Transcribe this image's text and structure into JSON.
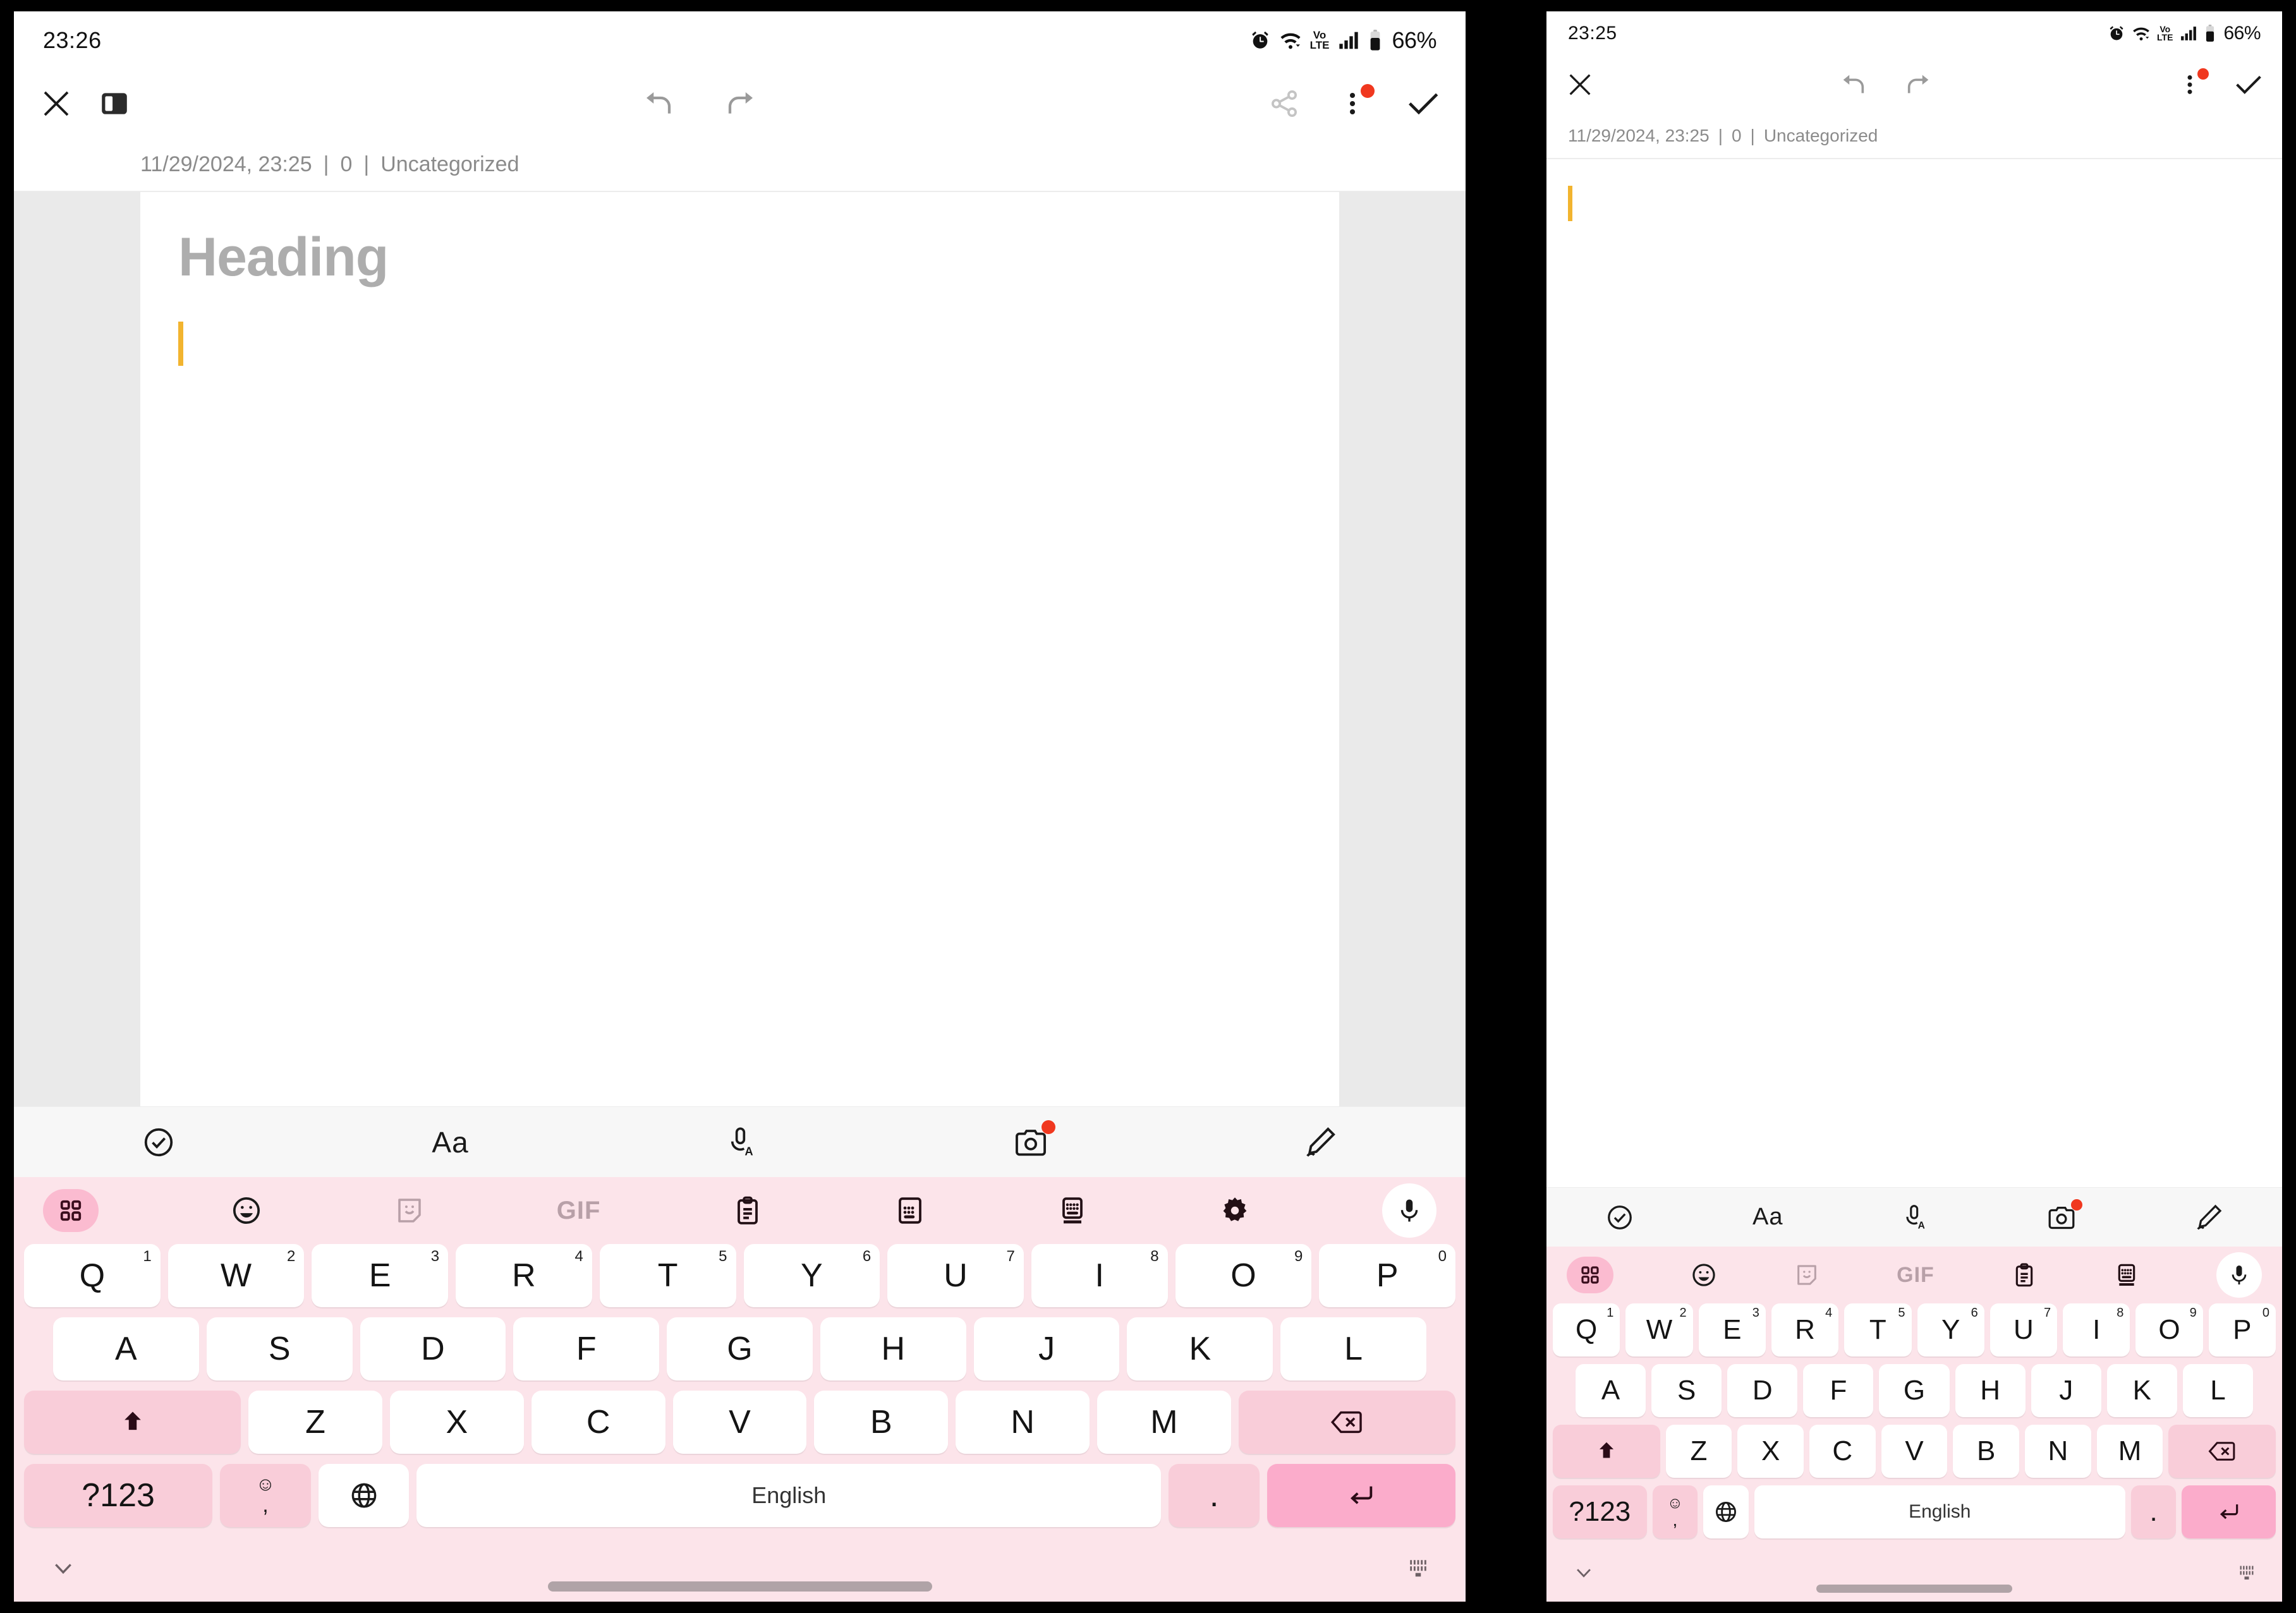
{
  "panels": {
    "left": {
      "status": {
        "time": "23:26",
        "battery": "66%",
        "volte_top": "Vo",
        "volte_bottom": "LTE"
      },
      "toolbar": {
        "close_label": "close-icon",
        "sidebar_label": "sidebar-toggle-icon",
        "undo_label": "undo-icon",
        "redo_label": "redo-icon",
        "share_label": "share-icon",
        "more_label": "more-vertical-icon",
        "done_label": "check-icon",
        "has_badge": true
      },
      "meta": {
        "date": "11/29/2024, 23:25",
        "count": "0",
        "category": "Uncategorized",
        "separator": "|"
      },
      "editor": {
        "heading_placeholder": "Heading",
        "body_text": ""
      },
      "format_bar": [
        "checkbox-circle-icon",
        "text-format-icon",
        "voice-typing-icon",
        "camera-icon",
        "draw-icon"
      ],
      "format_aa_label": "Aa",
      "keyboard": {
        "toolbar_icons": [
          "grid-menu-icon",
          "emoji-icon",
          "sticker-icon",
          "gif-icon",
          "clipboard-icon",
          "split-keyboard-icon",
          "floating-keyboard-icon",
          "settings-gear-icon",
          "mic-icon"
        ],
        "gif_label": "GIF",
        "row1": [
          {
            "k": "Q",
            "n": "1"
          },
          {
            "k": "W",
            "n": "2"
          },
          {
            "k": "E",
            "n": "3"
          },
          {
            "k": "R",
            "n": "4"
          },
          {
            "k": "T",
            "n": "5"
          },
          {
            "k": "Y",
            "n": "6"
          },
          {
            "k": "U",
            "n": "7"
          },
          {
            "k": "I",
            "n": "8"
          },
          {
            "k": "O",
            "n": "9"
          },
          {
            "k": "P",
            "n": "0"
          }
        ],
        "row2": [
          "A",
          "S",
          "D",
          "F",
          "G",
          "H",
          "J",
          "K",
          "L"
        ],
        "row3": [
          "Z",
          "X",
          "C",
          "V",
          "B",
          "N",
          "M"
        ],
        "shift_label": "shift-icon",
        "backspace_label": "backspace-icon",
        "numeric_label": "?123",
        "emoji_comma_top": "☺",
        "emoji_comma_bottom": ",",
        "globe_label": "globe-icon",
        "space_label": "English",
        "period_label": ".",
        "enter_label": "enter-icon",
        "hide_label": "chevron-down-icon",
        "resize_label": "keyboard-resize-icon"
      }
    },
    "right": {
      "status": {
        "time": "23:25",
        "battery": "66%",
        "volte_top": "Vo",
        "volte_bottom": "LTE"
      },
      "toolbar": {
        "close_label": "close-icon",
        "undo_label": "undo-icon",
        "redo_label": "redo-icon",
        "more_label": "more-vertical-icon",
        "done_label": "check-icon",
        "has_badge": true
      },
      "meta": {
        "date": "11/29/2024, 23:25",
        "count": "0",
        "category": "Uncategorized",
        "separator": "|"
      },
      "editor": {
        "heading_placeholder": "",
        "body_text": ""
      },
      "format_bar": [
        "checkbox-circle-icon",
        "text-format-icon",
        "voice-typing-icon",
        "camera-icon",
        "draw-icon"
      ],
      "format_aa_label": "Aa",
      "keyboard": {
        "toolbar_icons": [
          "grid-menu-icon",
          "emoji-icon",
          "sticker-icon",
          "gif-icon",
          "clipboard-icon",
          "floating-keyboard-icon",
          "mic-icon"
        ],
        "gif_label": "GIF",
        "row1": [
          {
            "k": "Q",
            "n": "1"
          },
          {
            "k": "W",
            "n": "2"
          },
          {
            "k": "E",
            "n": "3"
          },
          {
            "k": "R",
            "n": "4"
          },
          {
            "k": "T",
            "n": "5"
          },
          {
            "k": "Y",
            "n": "6"
          },
          {
            "k": "U",
            "n": "7"
          },
          {
            "k": "I",
            "n": "8"
          },
          {
            "k": "O",
            "n": "9"
          },
          {
            "k": "P",
            "n": "0"
          }
        ],
        "row2": [
          "A",
          "S",
          "D",
          "F",
          "G",
          "H",
          "J",
          "K",
          "L"
        ],
        "row3": [
          "Z",
          "X",
          "C",
          "V",
          "B",
          "N",
          "M"
        ],
        "shift_label": "shift-icon",
        "backspace_label": "backspace-icon",
        "numeric_label": "?123",
        "emoji_comma_top": "☺",
        "emoji_comma_bottom": ",",
        "globe_label": "globe-icon",
        "space_label": "English",
        "period_label": ".",
        "enter_label": "enter-icon",
        "hide_label": "chevron-down-icon",
        "resize_label": "keyboard-resize-icon"
      }
    }
  },
  "colors": {
    "keyboard_bg": "#FCE4EA",
    "key_bg": "#FFFFFF",
    "key_tinted": "#F9CDD9",
    "key_accent": "#FBACCB",
    "accent_pill": "#FBBBD0",
    "caret": "#F2B42F",
    "badge_red": "#F0381F",
    "placeholder_grey": "#ADADAD",
    "meta_grey": "#8B8B8B",
    "page_gutter": "#EAEAEA",
    "fmtbar_bg": "#F7F7F7"
  }
}
